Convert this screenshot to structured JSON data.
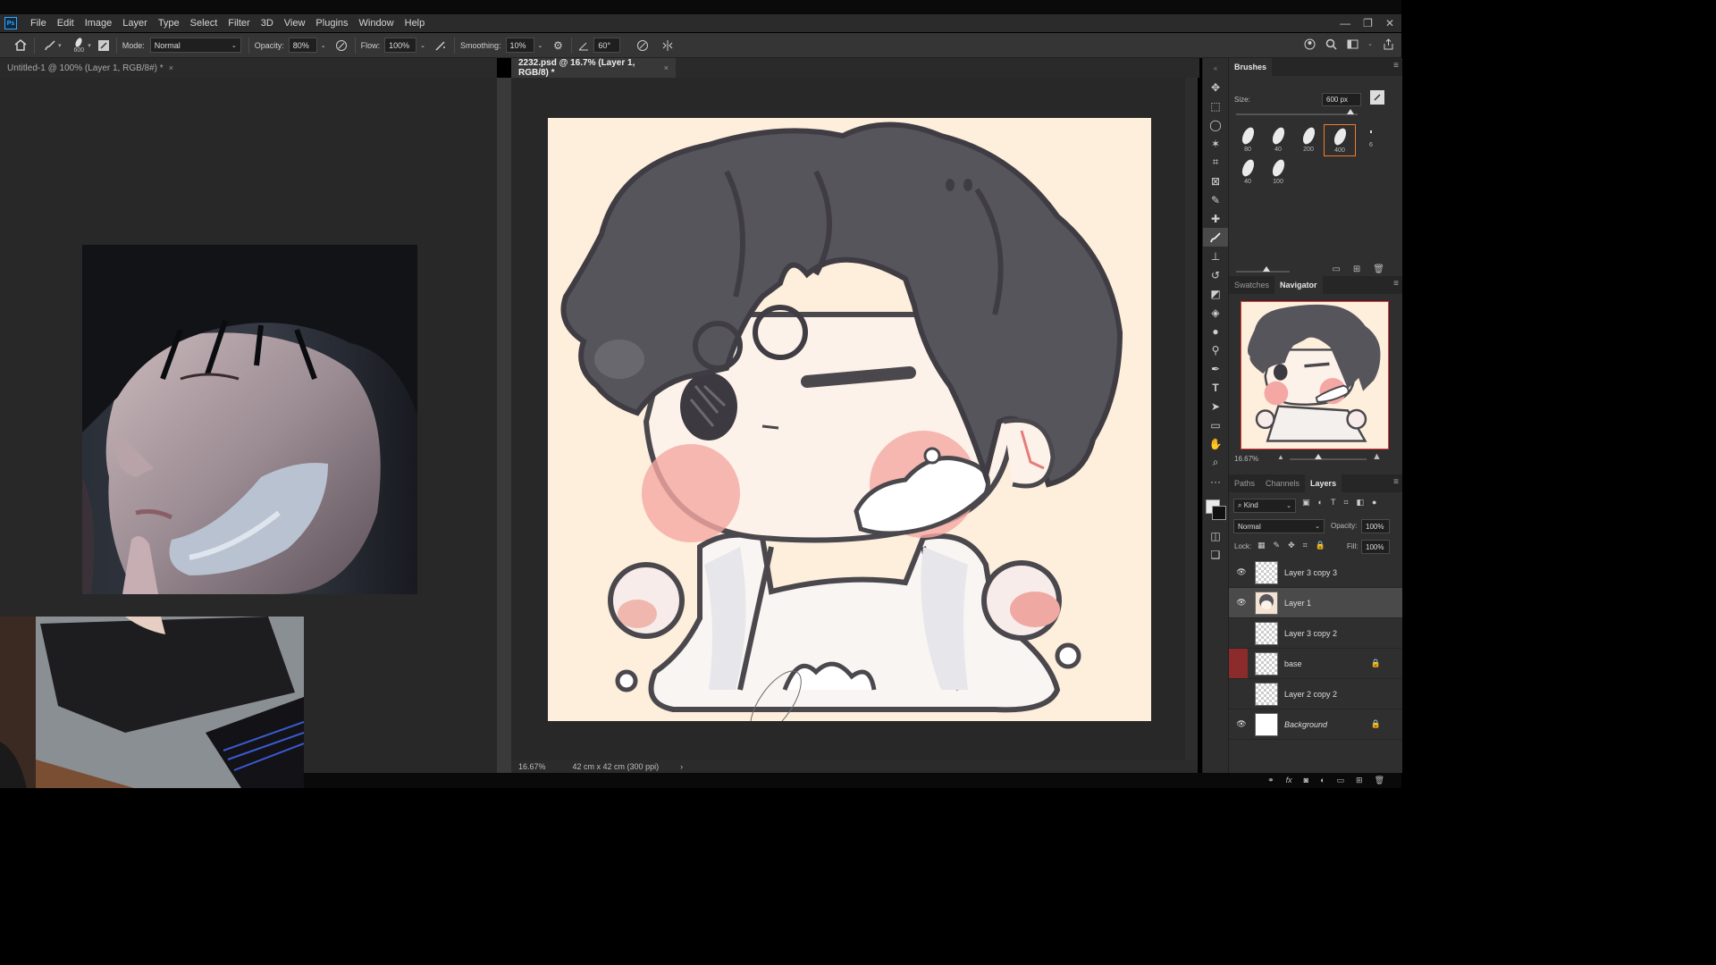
{
  "app": {
    "logo": "Ps"
  },
  "menu": [
    "File",
    "Edit",
    "Image",
    "Layer",
    "Type",
    "Select",
    "Filter",
    "3D",
    "View",
    "Plugins",
    "Window",
    "Help"
  ],
  "window_controls": {
    "minimize": "—",
    "restore": "❐",
    "close": "✕"
  },
  "options": {
    "brush_size": "600",
    "mode_label": "Mode:",
    "mode_value": "Normal",
    "opacity_label": "Opacity:",
    "opacity_value": "80%",
    "flow_label": "Flow:",
    "flow_value": "100%",
    "smoothing_label": "Smoothing:",
    "smoothing_value": "10%",
    "angle_value": "60°"
  },
  "tabs": {
    "left": "Untitled-1 @ 100% (Layer 1, RGB/8#) *",
    "right": "2232.psd @ 16.7% (Layer 1, RGB/8) *",
    "close": "×"
  },
  "status": {
    "zoom": "16.67%",
    "doc_info": "42 cm x 42 cm (300 ppi)",
    "arrow": "›"
  },
  "brushes_panel": {
    "title": "Brushes",
    "size_label": "Size:",
    "size_value": "600 px",
    "tips": [
      "80",
      "40",
      "200",
      "400",
      "6",
      "40",
      "100"
    ],
    "selected_tip": "400"
  },
  "navigator_panel": {
    "tabs": [
      "Swatches",
      "Navigator"
    ],
    "active": "Navigator",
    "zoom": "16.67%"
  },
  "layers_panel": {
    "tabs": [
      "Paths",
      "Channels",
      "Layers"
    ],
    "active": "Layers",
    "filter_label": "Kind",
    "blend_mode": "Normal",
    "opacity_label": "Opacity:",
    "opacity_value": "100%",
    "lock_label": "Lock:",
    "fill_label": "Fill:",
    "fill_value": "100%",
    "layers": [
      {
        "name": "Layer 3 copy 3",
        "visible": true
      },
      {
        "name": "Layer 1",
        "visible": true,
        "selected": true
      },
      {
        "name": "Layer 3 copy 2",
        "visible": false
      },
      {
        "name": "base",
        "visible": false,
        "locked": true
      },
      {
        "name": "Layer 2 copy 2",
        "visible": false
      },
      {
        "name": "Background",
        "visible": true,
        "locked": true
      }
    ]
  }
}
